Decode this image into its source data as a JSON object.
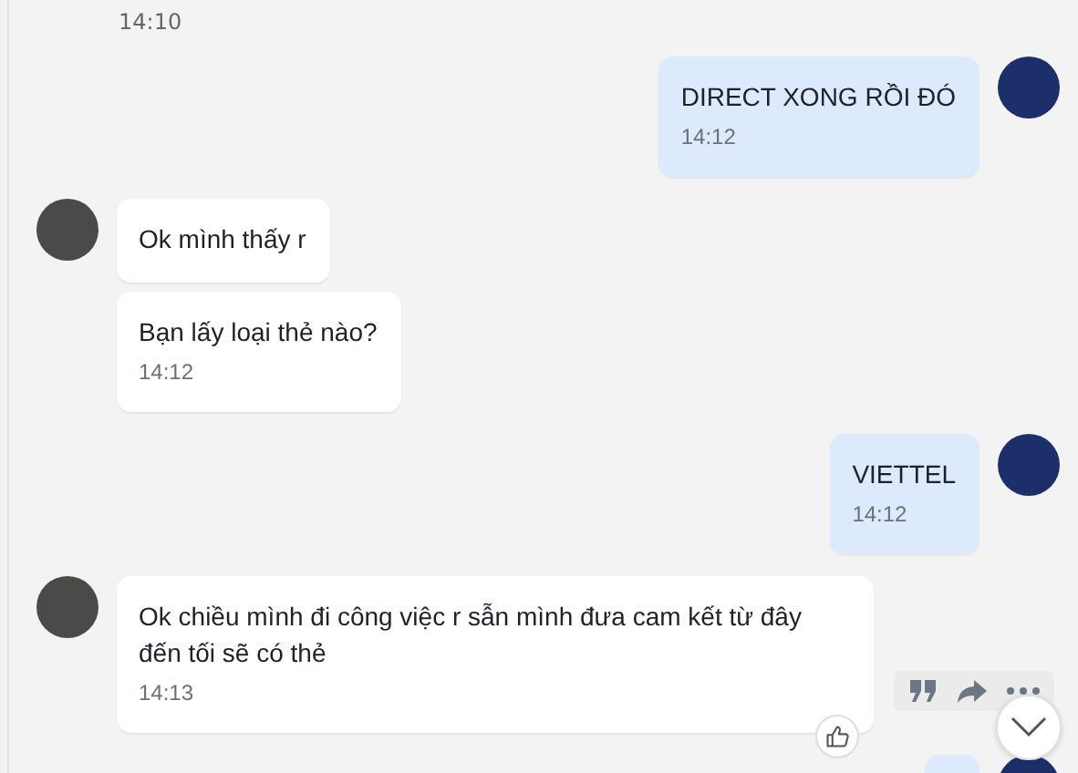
{
  "earlier_time": "14:10",
  "messages": [
    {
      "kind": "outgoing",
      "bubbles": [
        {
          "text": "DIRECT XONG RỒI ĐÓ",
          "time": "14:12"
        }
      ]
    },
    {
      "kind": "incoming",
      "bubbles": [
        {
          "text": "Ok mình thấy r"
        },
        {
          "text": "Bạn lấy loại thẻ nào?",
          "time": "14:12"
        }
      ]
    },
    {
      "kind": "outgoing",
      "bubbles": [
        {
          "text": "VIETTEL",
          "time": "14:12"
        }
      ]
    },
    {
      "kind": "incoming",
      "hover_actions": true,
      "bubbles": [
        {
          "text": "Ok chiều mình đi công việc r sẫn mình đưa cam kết từ đây đến tối sẽ có thẻ",
          "time": "14:13"
        }
      ]
    },
    {
      "kind": "outgoing",
      "partial": true
    }
  ],
  "scroll_to_bottom_button": true
}
